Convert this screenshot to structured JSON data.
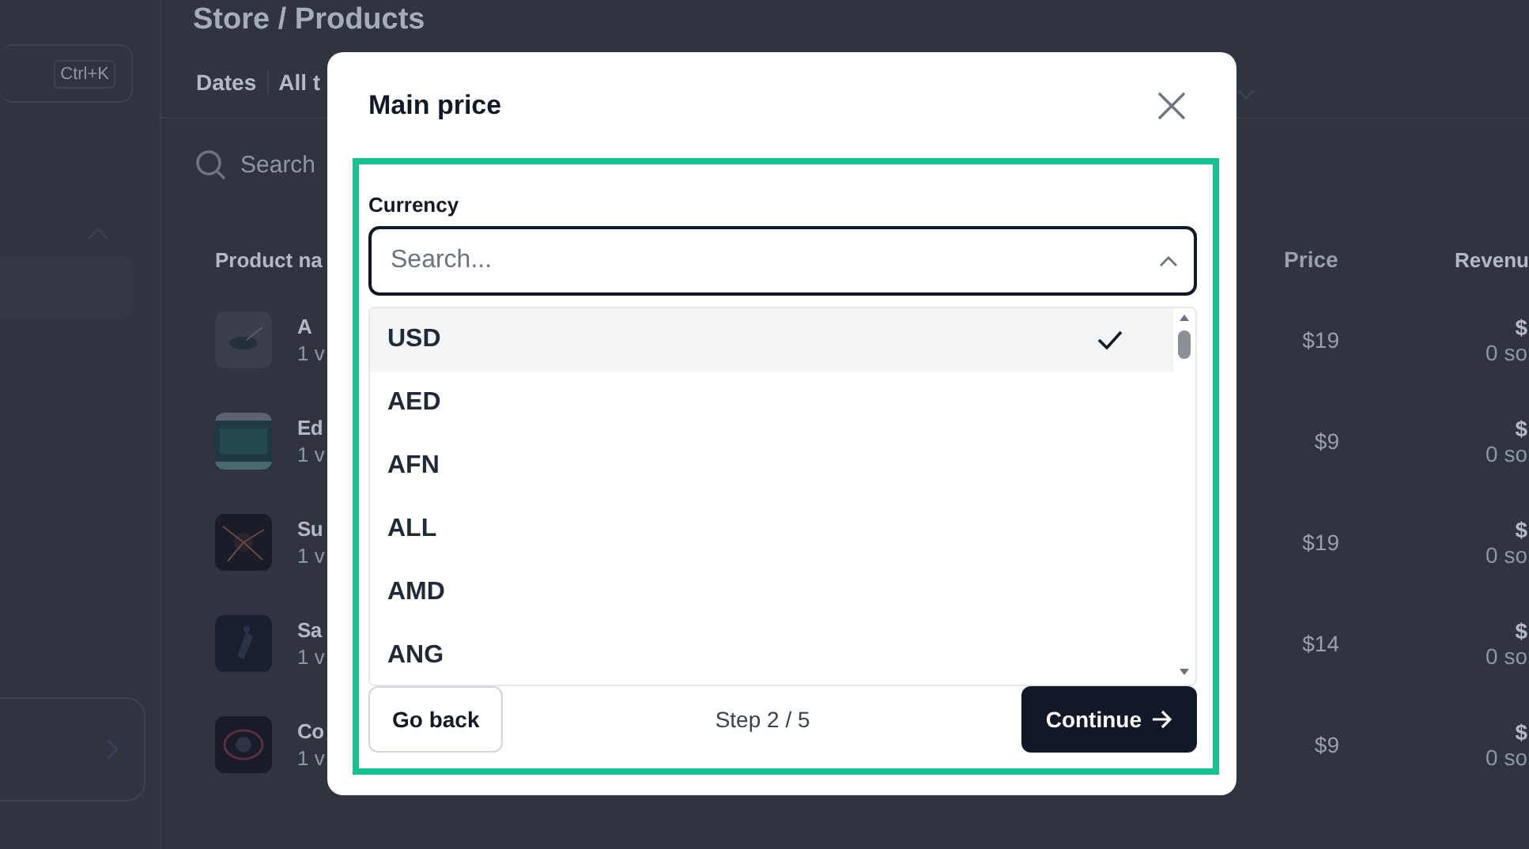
{
  "sidebar": {
    "shortcut": "Ctrl+K"
  },
  "page": {
    "title": "Store / Products",
    "filter_label": "Dates",
    "filter_value": "All t",
    "search_placeholder": "Search"
  },
  "table": {
    "columns": [
      "Product na",
      "Price",
      "Revenu"
    ],
    "rows": [
      {
        "name": "A",
        "variants": "1 v",
        "price": "$19",
        "revenue": "$",
        "sales": "0 so"
      },
      {
        "name": "Ed",
        "variants": "1 v",
        "price": "$9",
        "revenue": "$",
        "sales": "0 so"
      },
      {
        "name": "Su",
        "variants": "1 v",
        "price": "$19",
        "revenue": "$",
        "sales": "0 so"
      },
      {
        "name": "Sa",
        "variants": "1 v",
        "price": "$14",
        "revenue": "$",
        "sales": "0 so"
      },
      {
        "name": "Co",
        "variants": "1 v",
        "price": "$9",
        "revenue": "$",
        "sales": "0 so"
      }
    ]
  },
  "dialog": {
    "title": "Main price",
    "field_label": "Currency",
    "search": {
      "placeholder": "Search..."
    },
    "options": [
      {
        "code": "USD",
        "selected": true
      },
      {
        "code": "AED",
        "selected": false
      },
      {
        "code": "AFN",
        "selected": false
      },
      {
        "code": "ALL",
        "selected": false
      },
      {
        "code": "AMD",
        "selected": false
      },
      {
        "code": "ANG",
        "selected": false
      }
    ],
    "back": "Go back",
    "step": "Step 2 / 5",
    "continue": "Continue"
  }
}
